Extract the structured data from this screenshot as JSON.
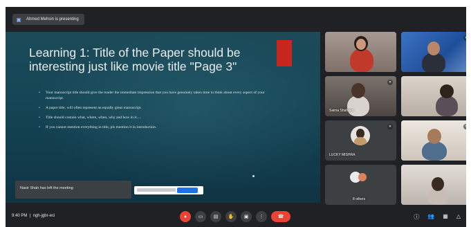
{
  "presenting": {
    "label": "Ahmed Mehsin is presenting"
  },
  "slide": {
    "title": "Learning 1: Title of the Paper should be interesting just like movie title \"Page 3\"",
    "bullets": [
      "Your manuscript title should give the reader the immediate impression that you have genuinely taken time to think about every aspect of your manuscript.",
      "A paper title, will often represent an equally great manuscript.",
      "Title should contain what, where, when, why and how in it.....",
      "If you cannot mention everything in title, pls mention it in introduction."
    ]
  },
  "toast": {
    "text": "Nasir Shah has left the meeting"
  },
  "participants": [
    {
      "name": ""
    },
    {
      "name": ""
    },
    {
      "name": "Saima Shaheen"
    },
    {
      "name": ""
    },
    {
      "name": "LUCKY MISHRA"
    },
    {
      "name": ""
    },
    {
      "name": "8 others"
    },
    {
      "name": ""
    }
  ],
  "bottom": {
    "time": "9:40 PM",
    "meeting_code": "ngh-jgbr-eci"
  },
  "icons": {
    "presenting": "present-icon",
    "mic": "mic-off-icon",
    "camera": "camera-icon",
    "captions": "captions-icon",
    "hand": "raise-hand-icon",
    "present": "present-now-icon",
    "more": "more-options-icon",
    "hangup": "hangup-icon",
    "info": "info-icon",
    "people": "people-icon",
    "chat": "chat-icon",
    "activities": "activities-icon"
  },
  "colors": {
    "meet_background": "#202124",
    "hangup": "#ea4335",
    "accent": "#1a73e8",
    "slide_red_tab": "#c8261e"
  }
}
